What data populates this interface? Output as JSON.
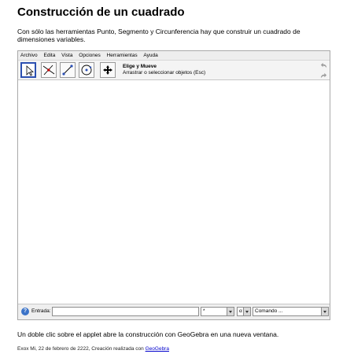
{
  "page": {
    "title": "Construcción de un cuadrado",
    "intro": "Con sólo las herramientas Punto, Segmento y Circunferencia hay que construir un cuadrado de dimensiones variables.",
    "note": "Un doble clic sobre el applet abre la construcción con GeoGebra en una nueva ventana.",
    "footer_text": "Exox Mi, 22 de febrero de 2222, Creación realizada con ",
    "footer_link": "GeoGebra"
  },
  "menu": [
    "Archivo",
    "Edita",
    "Vista",
    "Opciones",
    "Herramientas",
    "Ayuda"
  ],
  "toolbar": {
    "tools": [
      {
        "icon": "move-arrow-icon",
        "selected": true
      },
      {
        "icon": "intersect-point-icon",
        "selected": false
      },
      {
        "icon": "segment-icon",
        "selected": false
      },
      {
        "icon": "circle-center-point-icon",
        "selected": false
      },
      {
        "icon": "move-view-icon",
        "selected": false
      }
    ],
    "help_name": "Elige y Mueve",
    "help_desc": "Arrastrar o seleccionar objetos (Esc)"
  },
  "inputbar": {
    "label": "Entrada:",
    "value": "",
    "symbol_combo": "*",
    "greek_combo": "α",
    "command_combo": "Comando ..."
  }
}
